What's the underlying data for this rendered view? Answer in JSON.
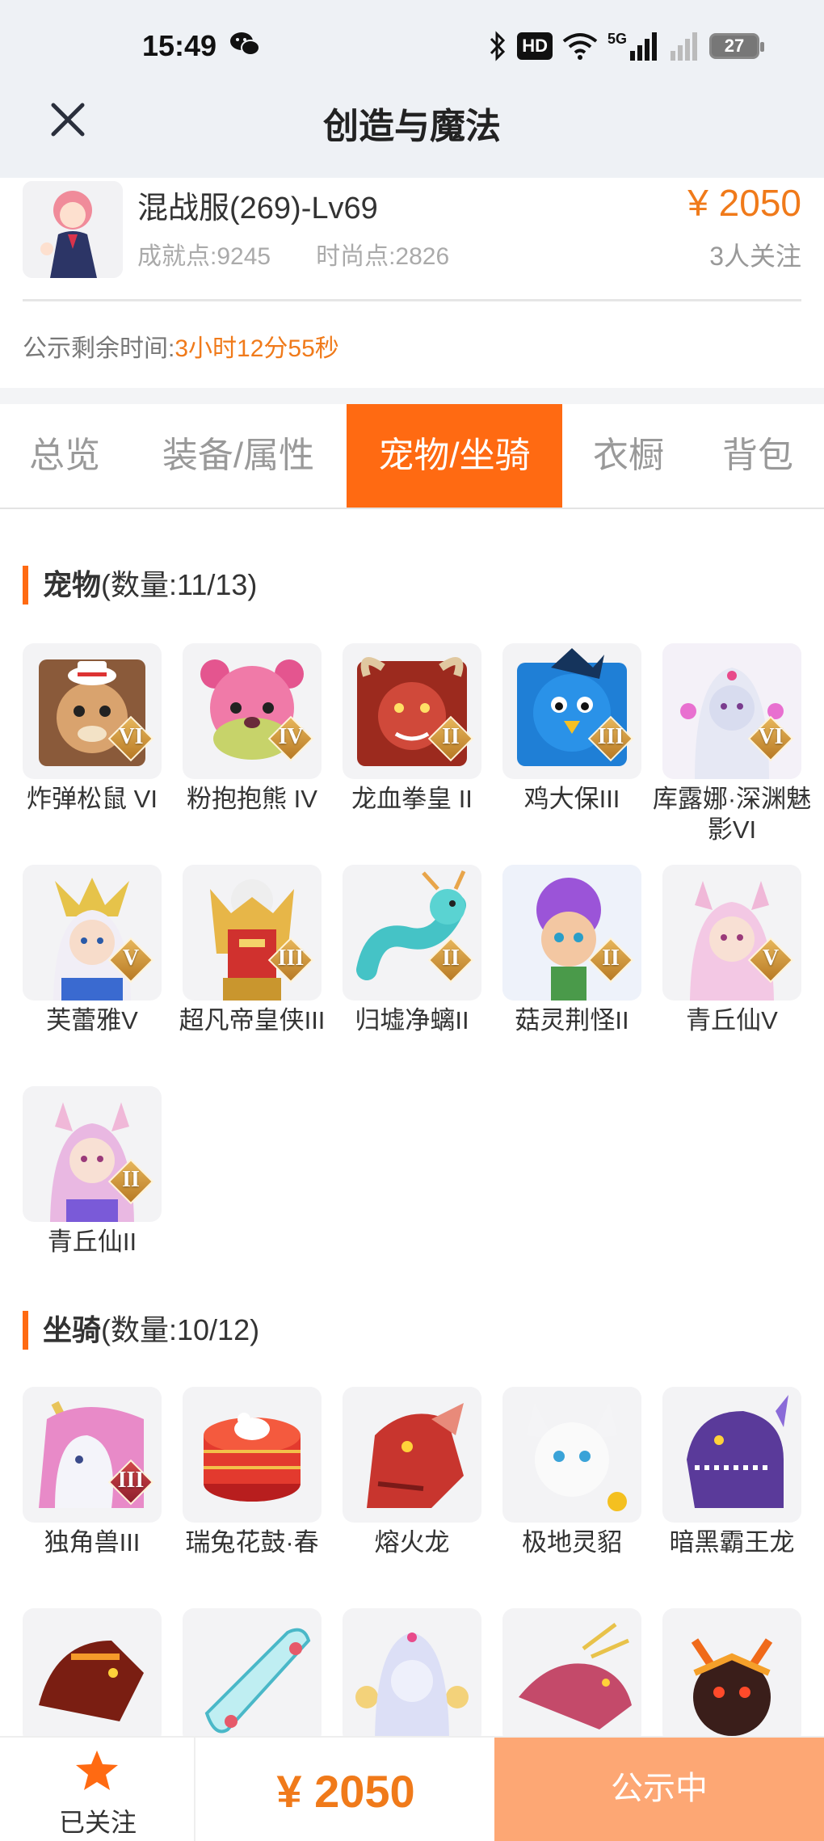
{
  "status_bar": {
    "time": "15:49",
    "hd": "HD",
    "network": "5G",
    "battery": "27"
  },
  "header": {
    "title": "创造与魔法"
  },
  "item": {
    "server": "混战服(269)-Lv69",
    "achievement": "成就点:9245",
    "fashion": "时尚点:2826",
    "price": "¥ 2050",
    "followers": "3人关注",
    "countdown_label": "公示剩余时间:",
    "countdown_value": "3小时12分55秒"
  },
  "tabs": [
    {
      "label": "总览",
      "active": false
    },
    {
      "label": "装备/属性",
      "active": false
    },
    {
      "label": "宠物/坐骑",
      "active": true
    },
    {
      "label": "衣橱",
      "active": false
    },
    {
      "label": "背包",
      "active": false
    }
  ],
  "pets": {
    "title": "宠物",
    "count": "(数量:11/13)",
    "items": [
      {
        "name": "炸弹松鼠 VI",
        "badge": "VI"
      },
      {
        "name": "粉抱抱熊 IV",
        "badge": "IV"
      },
      {
        "name": "龙血拳皇 II",
        "badge": "II"
      },
      {
        "name": "鸡大保III",
        "badge": "III"
      },
      {
        "name": "库露娜·深渊魅影VI",
        "badge": "VI"
      },
      {
        "name": "芙蕾雅V",
        "badge": "V"
      },
      {
        "name": "超凡帝皇侠III",
        "badge": "III"
      },
      {
        "name": "归墟净螭II",
        "badge": "II"
      },
      {
        "name": "菇灵荆怪II",
        "badge": "II"
      },
      {
        "name": "青丘仙V",
        "badge": "V"
      },
      {
        "name": "青丘仙II",
        "badge": "II"
      }
    ]
  },
  "mounts": {
    "title": "坐骑",
    "count": "(数量:10/12)",
    "items": [
      {
        "name": "独角兽III",
        "badge": "III"
      },
      {
        "name": "瑞兔花鼓·春",
        "badge": ""
      },
      {
        "name": "熔火龙",
        "badge": ""
      },
      {
        "name": "极地灵貂",
        "badge": ""
      },
      {
        "name": "暗黑霸王龙",
        "badge": ""
      }
    ]
  },
  "bottom": {
    "follow_label": "已关注",
    "price": "¥ 2050",
    "status": "公示中"
  },
  "colors": {
    "accent": "#ff6a12",
    "price": "#f07a1a",
    "status_button": "#fda774"
  }
}
